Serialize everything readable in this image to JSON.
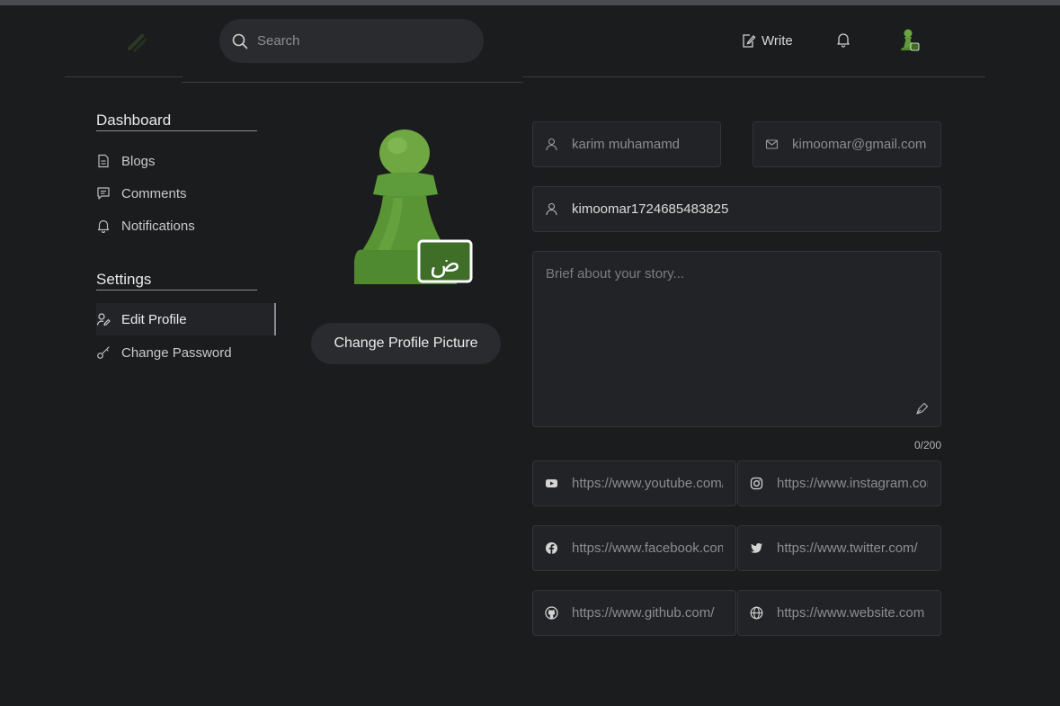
{
  "nav": {
    "search_placeholder": "Search",
    "write_label": "Write"
  },
  "sidebar": {
    "dashboard_heading": "Dashboard",
    "dashboard_items": [
      {
        "label": "Blogs",
        "icon": "document-icon"
      },
      {
        "label": "Comments",
        "icon": "comment-icon"
      },
      {
        "label": "Notifications",
        "icon": "bell-icon"
      }
    ],
    "settings_heading": "Settings",
    "settings_items": [
      {
        "label": "Edit Profile",
        "icon": "user-edit-icon",
        "active": true
      },
      {
        "label": "Change Password",
        "icon": "key-icon",
        "active": false
      }
    ]
  },
  "profile": {
    "avatar_badge": "ض",
    "change_picture_label": "Change Profile Picture"
  },
  "form": {
    "fullname": "karim muhamamd",
    "email": "kimoomar@gmail.com",
    "username": "kimoomar1724685483825",
    "bio_placeholder": "Brief about your story...",
    "bio_value": "",
    "char_counter": "0/200",
    "socials": {
      "youtube": "https://www.youtube.com/",
      "instagram": "https://www.instagram.com/",
      "facebook": "https://www.facebook.com/",
      "twitter": "https://www.twitter.com/",
      "github": "https://www.github.com/",
      "website": "https://www.website.com"
    }
  },
  "colors": {
    "background": "#1b1c1e",
    "field_bg": "#222326",
    "accent_green": "#5e9b3a"
  }
}
